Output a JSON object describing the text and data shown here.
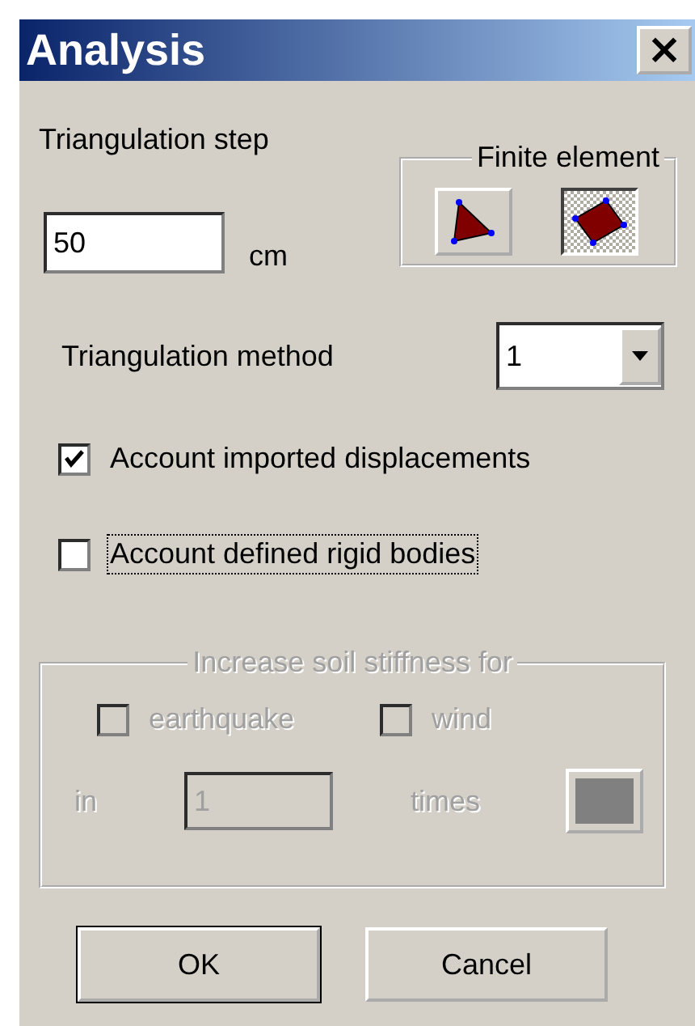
{
  "window": {
    "title": "Analysis",
    "close": "×"
  },
  "triangulation_step": {
    "label": "Triangulation step",
    "value": "50",
    "unit": "cm"
  },
  "finite_element": {
    "title": "Finite element",
    "buttons": [
      {
        "kind": "triangle",
        "selected": false
      },
      {
        "kind": "quad",
        "selected": true
      }
    ]
  },
  "triangulation_method": {
    "label": "Triangulation method",
    "value": "1"
  },
  "options": [
    {
      "label": "Account imported displacements",
      "checked": true,
      "focused": false
    },
    {
      "label": "Account defined rigid bodies",
      "checked": false,
      "focused": true
    }
  ],
  "soil_stiffness": {
    "title": "Increase soil stiffness for",
    "disabled": true,
    "checks": [
      {
        "label": "earthquake",
        "checked": false
      },
      {
        "label": "wind",
        "checked": false
      }
    ],
    "in_label": "in",
    "factor": "1",
    "times_label": "times"
  },
  "buttons": [
    {
      "label": "OK",
      "default": true
    },
    {
      "label": "Cancel",
      "default": false
    }
  ]
}
